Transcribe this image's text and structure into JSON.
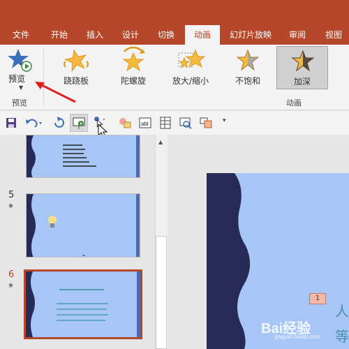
{
  "tabs": [
    {
      "label": "文件"
    },
    {
      "label": "开始"
    },
    {
      "label": "插入"
    },
    {
      "label": "设计"
    },
    {
      "label": "切换"
    },
    {
      "label": "动画"
    },
    {
      "label": "幻灯片放映"
    },
    {
      "label": "审阅"
    },
    {
      "label": "视图"
    }
  ],
  "active_tab": "动画",
  "ribbon": {
    "preview": {
      "label": "预览",
      "group_label": "预览",
      "icon": "star-play-icon"
    },
    "animation_group_label": "动画",
    "animations": [
      {
        "label": "跷跷板",
        "icon": "seesaw-star-icon"
      },
      {
        "label": "陀螺旋",
        "icon": "spin-star-icon"
      },
      {
        "label": "放大/缩小",
        "icon": "grow-shrink-star-icon"
      },
      {
        "label": "不饱和",
        "icon": "desaturate-star-icon"
      },
      {
        "label": "加深",
        "icon": "darken-star-icon",
        "selected": true
      }
    ]
  },
  "quick_access": [
    {
      "icon": "save-icon"
    },
    {
      "icon": "undo-icon"
    },
    {
      "icon": "redo-icon"
    },
    {
      "icon": "from-start-icon"
    },
    {
      "icon": "touch-mode-icon"
    },
    {
      "icon": "shapes-icon"
    },
    {
      "icon": "textbox-icon"
    },
    {
      "icon": "table-icon"
    },
    {
      "icon": "find-icon"
    },
    {
      "icon": "format-painter-icon"
    },
    {
      "icon": "customize-icon"
    }
  ],
  "slides": [
    {
      "number": "",
      "star": ""
    },
    {
      "number": "5",
      "star": "★"
    },
    {
      "number": "6",
      "star": "★",
      "selected": true
    }
  ],
  "canvas": {
    "animation_tag": "1",
    "visible_chars": [
      "人",
      "等"
    ]
  },
  "watermark": {
    "text": "Bai经验",
    "sub": "jingyan.baidu.com"
  },
  "colors": {
    "accent": "#b7472a",
    "ribbon": "#f3f3f3",
    "slide_bg": "#a8c6f5",
    "wave_dark": "#262a55",
    "star": "#f5b940"
  }
}
